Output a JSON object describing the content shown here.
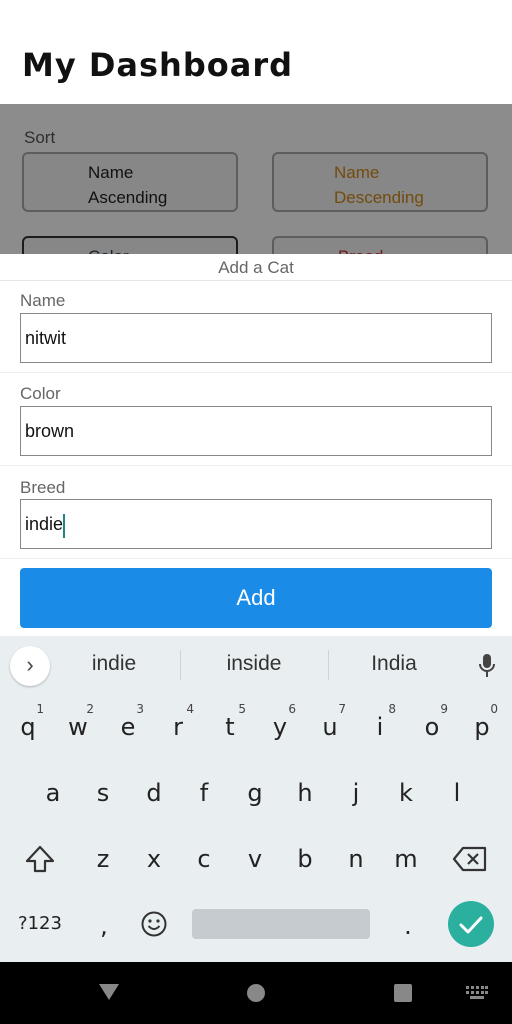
{
  "header": {
    "title": "My Dashboard"
  },
  "background": {
    "sort_label": "Sort",
    "sort_buttons": [
      {
        "label_line1": "Name",
        "label_line2": "Ascending"
      },
      {
        "label_line1": "Name",
        "label_line2": "Descending"
      },
      {
        "label_line1": "Color"
      },
      {
        "label_line1": "Breed"
      }
    ]
  },
  "modal": {
    "title": "Add a Cat",
    "fields": [
      {
        "label": "Name",
        "value": "nitwit"
      },
      {
        "label": "Color",
        "value": "brown"
      },
      {
        "label": "Breed",
        "value": "indie"
      }
    ],
    "submit_label": "Add"
  },
  "keyboard": {
    "suggestions": [
      "indie",
      "inside",
      "India"
    ],
    "rows": {
      "row1": [
        "q",
        "w",
        "e",
        "r",
        "t",
        "y",
        "u",
        "i",
        "o",
        "p"
      ],
      "row1_numbers": [
        "1",
        "2",
        "3",
        "4",
        "5",
        "6",
        "7",
        "8",
        "9",
        "0"
      ],
      "row2": [
        "a",
        "s",
        "d",
        "f",
        "g",
        "h",
        "j",
        "k",
        "l"
      ],
      "row3": [
        "z",
        "x",
        "c",
        "v",
        "b",
        "n",
        "m"
      ],
      "bottom": {
        "symbols": "?123",
        "comma": ",",
        "period": "."
      }
    },
    "icons": [
      "chevron-right-icon",
      "mic-icon",
      "shift-icon",
      "backspace-icon",
      "emoji-icon",
      "check-icon"
    ]
  },
  "navbar": {
    "icons": [
      "back-icon",
      "home-icon",
      "recents-icon",
      "keyboard-switch-icon"
    ]
  },
  "colors": {
    "primary": "#1b8be8",
    "enter_key": "#2bb0a0",
    "descending_text": "#d08a18"
  }
}
